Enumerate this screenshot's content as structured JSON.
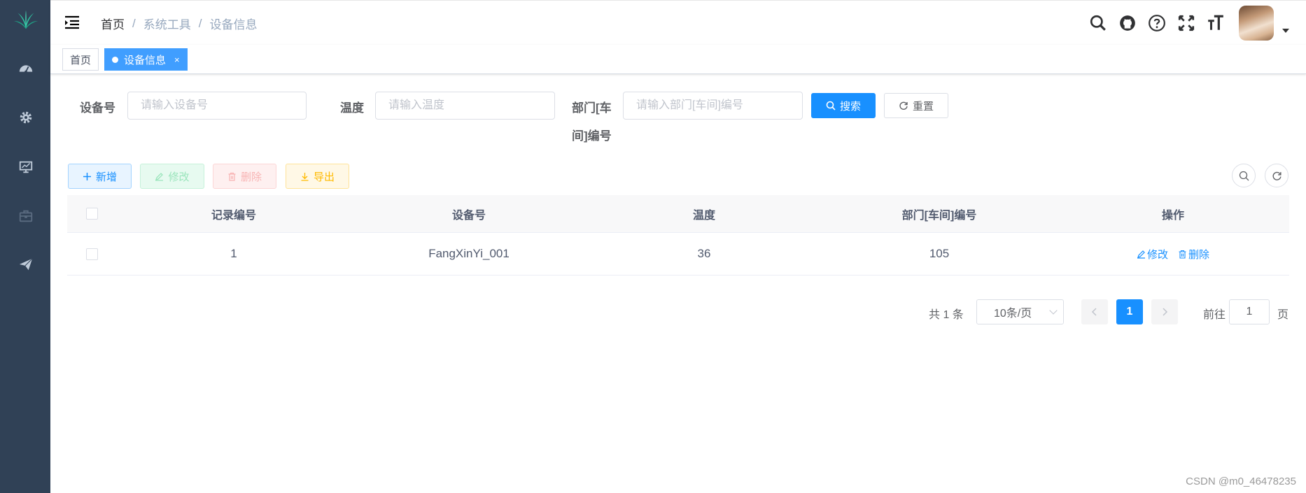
{
  "sidebar": {
    "icons": [
      "logo-icon",
      "dashboard-icon",
      "gear-icon",
      "monitor-icon",
      "toolbox-icon",
      "paper-plane-icon"
    ]
  },
  "navbar": {
    "breadcrumb": [
      "首页",
      "系统工具",
      "设备信息"
    ],
    "breadcrumb_sep": "/",
    "right_icons": [
      "search-icon",
      "github-icon",
      "question-icon",
      "fullscreen-icon",
      "font-size-icon"
    ]
  },
  "tags": [
    {
      "label": "首页",
      "active": false
    },
    {
      "label": "设备信息",
      "active": true,
      "close": "×"
    }
  ],
  "search_form": {
    "device_label": "设备号",
    "device_placeholder": "请输入设备号",
    "temp_label": "温度",
    "temp_placeholder": "请输入温度",
    "dept_label_line1": "部门[车",
    "dept_label_line2": "间]编号",
    "dept_placeholder": "请输入部门[车间]编号",
    "search_button": "搜索",
    "reset_button": "重置"
  },
  "toolbar": {
    "add": "新增",
    "edit": "修改",
    "delete": "删除",
    "export": "导出"
  },
  "table": {
    "columns": [
      "记录编号",
      "设备号",
      "温度",
      "部门[车间]编号",
      "操作"
    ],
    "rows": [
      {
        "id": "1",
        "device": "FangXinYi_001",
        "temp": "36",
        "dept": "105",
        "edit": "修改",
        "delete": "删除"
      }
    ]
  },
  "pagination": {
    "total": "共 1 条",
    "page_size": "10条/页",
    "current_page": "1",
    "goto_label": "前往",
    "goto_value": "1",
    "page_suffix": "页"
  },
  "watermark": "CSDN @m0_46478235",
  "colors": {
    "sidebar": "#304156",
    "primary": "#1890ff",
    "tag_active": "#409eff"
  }
}
